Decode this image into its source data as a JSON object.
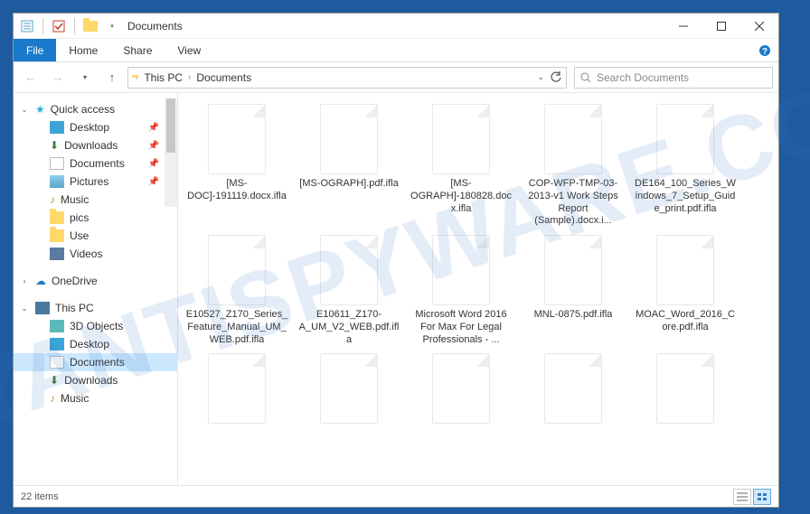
{
  "title": "Documents",
  "ribbon": {
    "file": "File",
    "home": "Home",
    "share": "Share",
    "view": "View"
  },
  "breadcrumb": {
    "root": "This PC",
    "current": "Documents"
  },
  "search": {
    "placeholder": "Search Documents"
  },
  "sidebar": {
    "quick_access": {
      "label": "Quick access",
      "items": [
        {
          "label": "Desktop",
          "pinned": true,
          "icon": "monitor"
        },
        {
          "label": "Downloads",
          "pinned": true,
          "icon": "down"
        },
        {
          "label": "Documents",
          "pinned": true,
          "icon": "doc"
        },
        {
          "label": "Pictures",
          "pinned": true,
          "icon": "pic"
        },
        {
          "label": "Music",
          "pinned": false,
          "icon": "music"
        },
        {
          "label": "pics",
          "pinned": false,
          "icon": "folder"
        },
        {
          "label": "Use",
          "pinned": false,
          "icon": "folder"
        },
        {
          "label": "Videos",
          "pinned": false,
          "icon": "video"
        }
      ]
    },
    "onedrive": {
      "label": "OneDrive"
    },
    "this_pc": {
      "label": "This PC",
      "items": [
        {
          "label": "3D Objects",
          "icon": "3d"
        },
        {
          "label": "Desktop",
          "icon": "monitor"
        },
        {
          "label": "Documents",
          "icon": "doc",
          "selected": true
        },
        {
          "label": "Downloads",
          "icon": "down"
        },
        {
          "label": "Music",
          "icon": "music"
        }
      ]
    }
  },
  "files": [
    {
      "name": "[MS-DOC]-191119.docx.ifla"
    },
    {
      "name": "[MS-OGRAPH].pdf.ifla"
    },
    {
      "name": "[MS-OGRAPH]-180828.docx.ifla"
    },
    {
      "name": "COP-WFP-TMP-03-2013-v1 Work Steps Report (Sample).docx.i..."
    },
    {
      "name": "DE164_100_Series_Windows_7_Setup_Guide_print.pdf.ifla"
    },
    {
      "name": "E10527_Z170_Series_Feature_Manual_UM_WEB.pdf.ifla"
    },
    {
      "name": "E10611_Z170-A_UM_V2_WEB.pdf.ifla"
    },
    {
      "name": "Microsoft Word 2016 For Max For Legal Professionals - ..."
    },
    {
      "name": "MNL-0875.pdf.ifla"
    },
    {
      "name": "MOAC_Word_2016_Core.pdf.ifla"
    },
    {
      "name": ""
    },
    {
      "name": ""
    },
    {
      "name": ""
    },
    {
      "name": ""
    },
    {
      "name": ""
    }
  ],
  "status": {
    "count": "22 items"
  },
  "watermark": "MYANTISPYWARE.COM"
}
